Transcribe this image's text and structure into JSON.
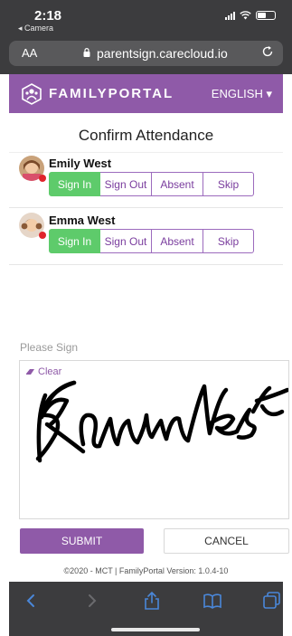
{
  "status_bar": {
    "time": "2:18",
    "back_app": "◂ Camera"
  },
  "browser": {
    "text_size_label": "AA",
    "url": "parentsign.carecloud.io"
  },
  "header": {
    "logo_text": "FAMILYPORTAL",
    "language": "ENGLISH ▾"
  },
  "page": {
    "title": "Confirm Attendance"
  },
  "students": [
    {
      "name": "Emily West",
      "actions": [
        "Sign In",
        "Sign Out",
        "Absent",
        "Skip"
      ],
      "selected": "Sign In"
    },
    {
      "name": "Emma West",
      "actions": [
        "Sign In",
        "Sign Out",
        "Absent",
        "Skip"
      ],
      "selected": "Sign In"
    }
  ],
  "signature": {
    "label": "Please Sign",
    "clear_label": "Clear"
  },
  "form": {
    "submit_label": "SUBMIT",
    "cancel_label": "CANCEL"
  },
  "footer": {
    "text": "©2020 - MCT | FamilyPortal  Version: 1.0.4-10"
  },
  "colors": {
    "brand": "#8f5aa8",
    "active": "#5ecb6b",
    "alert": "#e0242b"
  }
}
